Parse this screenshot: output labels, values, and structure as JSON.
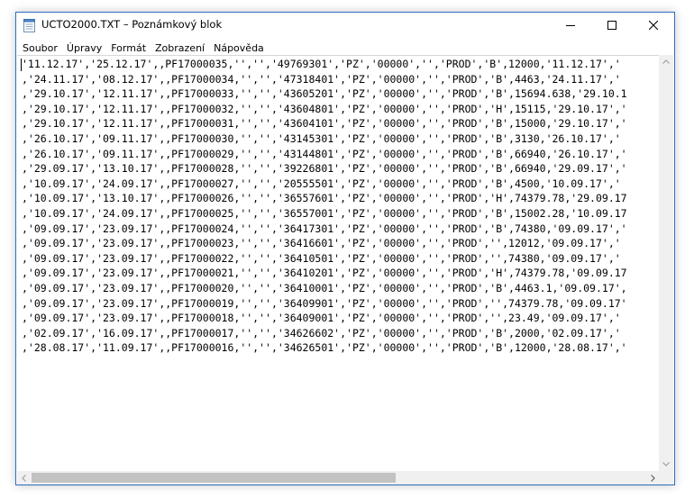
{
  "window": {
    "title": "UCTO2000.TXT – Poznámkový blok",
    "border_color": "#2b6fc4"
  },
  "title_controls": {
    "minimize_icon": "minimize-icon",
    "maximize_icon": "maximize-icon",
    "close_icon": "close-icon"
  },
  "menu": {
    "items": [
      "Soubor",
      "Úpravy",
      "Formát",
      "Zobrazení",
      "Nápověda"
    ]
  },
  "editor": {
    "lines": [
      "'11.12.17','25.12.17',,PF17000035,'','','49769301','PZ','00000','','PROD','B',12000,'11.12.17','",
      ",'24.11.17','08.12.17',,PF17000034,'','','47318401','PZ','00000','','PROD','B',4463,'24.11.17','",
      ",'29.10.17','12.11.17',,PF17000033,'','','43605201','PZ','00000','','PROD','B',15694.638,'29.10.1",
      ",'29.10.17','12.11.17',,PF17000032,'','','43604801','PZ','00000','','PROD','H',15115,'29.10.17','",
      ",'29.10.17','12.11.17',,PF17000031,'','','43604101','PZ','00000','','PROD','B',15000,'29.10.17','",
      ",'26.10.17','09.11.17',,PF17000030,'','','43145301','PZ','00000','','PROD','B',3130,'26.10.17','",
      ",'26.10.17','09.11.17',,PF17000029,'','','43144801','PZ','00000','','PROD','B',66940,'26.10.17','",
      ",'29.09.17','13.10.17',,PF17000028,'','','39226801','PZ','00000','','PROD','B',66940,'29.09.17','",
      ",'10.09.17','24.09.17',,PF17000027,'','','20555501','PZ','00000','','PROD','B',4500,'10.09.17','",
      ",'10.09.17','13.10.17',,PF17000026,'','','36557601','PZ','00000','','PROD','H',74379.78,'29.09.17",
      ",'10.09.17','24.09.17',,PF17000025,'','','36557001','PZ','00000','','PROD','B',15002.28,'10.09.17",
      ",'09.09.17','23.09.17',,PF17000024,'','','36417301','PZ','00000','','PROD','B',74380,'09.09.17','",
      ",'09.09.17','23.09.17',,PF17000023,'','','36416601','PZ','00000','','PROD','',12012,'09.09.17','",
      ",'09.09.17','23.09.17',,PF17000022,'','','36410501','PZ','00000','','PROD','',74380,'09.09.17','",
      ",'09.09.17','23.09.17',,PF17000021,'','','36410201','PZ','00000','','PROD','H',74379.78,'09.09.17",
      ",'09.09.17','23.09.17',,PF17000020,'','','36410001','PZ','00000','','PROD','B',4463.1,'09.09.17',",
      ",'09.09.17','23.09.17',,PF17000019,'','','36409901','PZ','00000','','PROD','',74379.78,'09.09.17'",
      ",'09.09.17','23.09.17',,PF17000018,'','','36409001','PZ','00000','','PROD','',23.49,'09.09.17','",
      ",'02.09.17','16.09.17',,PF17000017,'','','34626602','PZ','00000','','PROD','B',2000,'02.09.17','",
      ",'28.08.17','11.09.17',,PF17000016,'','','34626501','PZ','00000','','PROD','B',12000,'28.08.17','"
    ]
  },
  "scrollbars": {
    "horizontal_position": 0
  }
}
